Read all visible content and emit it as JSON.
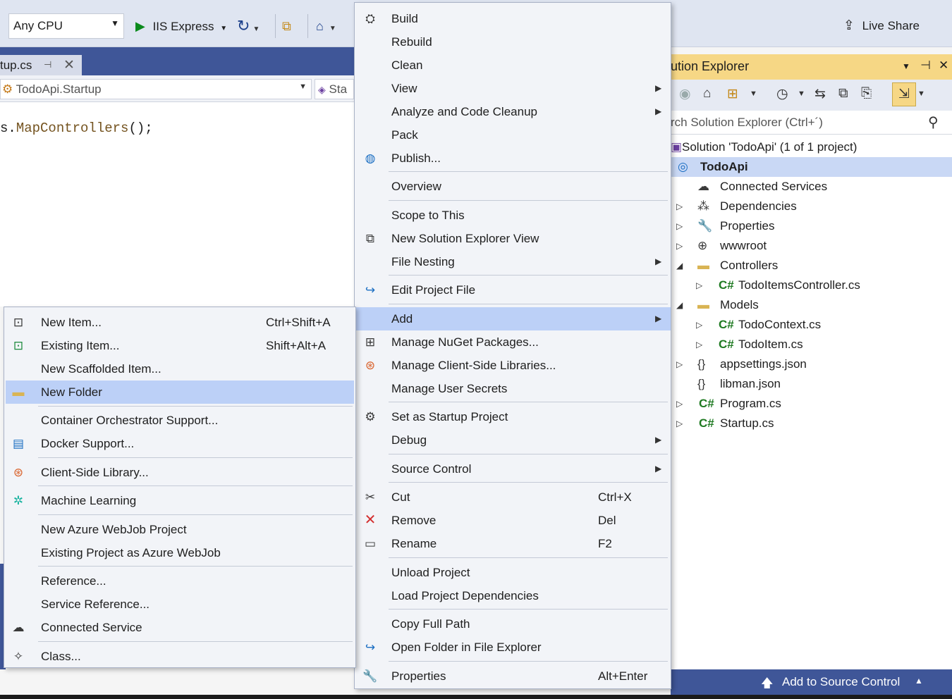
{
  "toolbar": {
    "platform": "Any CPU",
    "run_target": "IIS Express",
    "live_share": "Live Share"
  },
  "editor": {
    "tab_label": "tup.cs",
    "nav_left": "TodoApi.Startup",
    "nav_right": "Sta",
    "code_prefix": "s.",
    "code_method": "MapControllers",
    "code_suffix": "();"
  },
  "context_menu": {
    "items": [
      {
        "label": "Build",
        "icon": "build-icon"
      },
      {
        "label": "Rebuild"
      },
      {
        "label": "Clean"
      },
      {
        "label": "View",
        "submenu": true
      },
      {
        "label": "Analyze and Code Cleanup",
        "submenu": true
      },
      {
        "label": "Pack"
      },
      {
        "label": "Publish...",
        "icon": "globe-icon"
      },
      {
        "label": "Overview"
      },
      {
        "label": "Scope to This"
      },
      {
        "label": "New Solution Explorer View",
        "icon": "new-view-icon"
      },
      {
        "label": "File Nesting",
        "submenu": true
      },
      {
        "label": "Edit Project File",
        "icon": "edit-arrow-icon"
      },
      {
        "label": "Add",
        "submenu": true,
        "highlighted": true
      },
      {
        "label": "Manage NuGet Packages...",
        "icon": "nuget-icon"
      },
      {
        "label": "Manage Client-Side Libraries...",
        "icon": "client-lib-icon"
      },
      {
        "label": "Manage User Secrets"
      },
      {
        "label": "Set as Startup Project",
        "icon": "gear-icon"
      },
      {
        "label": "Debug",
        "submenu": true
      },
      {
        "label": "Source Control",
        "submenu": true
      },
      {
        "label": "Cut",
        "shortcut": "Ctrl+X",
        "icon": "scissors-icon"
      },
      {
        "label": "Remove",
        "shortcut": "Del",
        "icon": "remove-icon"
      },
      {
        "label": "Rename",
        "shortcut": "F2",
        "icon": "rename-icon"
      },
      {
        "label": "Unload Project"
      },
      {
        "label": "Load Project Dependencies"
      },
      {
        "label": "Copy Full Path"
      },
      {
        "label": "Open Folder in File Explorer",
        "icon": "open-folder-arrow-icon"
      },
      {
        "label": "Properties",
        "shortcut": "Alt+Enter",
        "icon": "wrench-icon"
      }
    ]
  },
  "add_submenu": {
    "items": [
      {
        "label": "New Item...",
        "shortcut": "Ctrl+Shift+A",
        "icon": "new-item-icon"
      },
      {
        "label": "Existing Item...",
        "shortcut": "Shift+Alt+A",
        "icon": "existing-item-icon"
      },
      {
        "label": "New Scaffolded Item..."
      },
      {
        "label": "New Folder",
        "highlighted": true,
        "icon": "new-folder-icon"
      },
      {
        "label": "Container Orchestrator Support..."
      },
      {
        "label": "Docker Support...",
        "icon": "docker-icon"
      },
      {
        "label": "Client-Side Library...",
        "icon": "client-lib-icon"
      },
      {
        "label": "Machine Learning",
        "icon": "ml-icon"
      },
      {
        "label": "New Azure WebJob Project"
      },
      {
        "label": "Existing Project as Azure WebJob"
      },
      {
        "label": "Reference..."
      },
      {
        "label": "Service Reference..."
      },
      {
        "label": "Connected Service",
        "icon": "connected-service-icon"
      },
      {
        "label": "Class...",
        "icon": "class-icon"
      }
    ]
  },
  "solution_explorer": {
    "title": "ution Explorer",
    "search_placeholder": "rch Solution Explorer (Ctrl+´)",
    "tree": [
      {
        "label": "Solution 'TodoApi' (1 of 1 project)",
        "icon": "solution-icon"
      },
      {
        "label": "TodoApi",
        "icon": "web-project-icon",
        "selected": true
      },
      {
        "label": "Connected Services",
        "icon": "connected-services-icon"
      },
      {
        "label": "Dependencies",
        "icon": "dependencies-icon"
      },
      {
        "label": "Properties",
        "icon": "wrench-icon"
      },
      {
        "label": "wwwroot",
        "icon": "globe-icon"
      },
      {
        "label": "Controllers",
        "icon": "folder-icon"
      },
      {
        "label": "TodoItemsController.cs",
        "icon": "csharp-icon"
      },
      {
        "label": "Models",
        "icon": "folder-icon"
      },
      {
        "label": "TodoContext.cs",
        "icon": "csharp-icon"
      },
      {
        "label": "TodoItem.cs",
        "icon": "csharp-icon"
      },
      {
        "label": "appsettings.json",
        "icon": "json-icon"
      },
      {
        "label": "libman.json",
        "icon": "json-icon"
      },
      {
        "label": "Program.cs",
        "icon": "csharp-icon"
      },
      {
        "label": "Startup.cs",
        "icon": "csharp-icon"
      }
    ]
  },
  "statusbar": {
    "source_control": "Add to Source Control"
  },
  "colors": {
    "accent": "#3f5698",
    "highlight": "#bcd0f7",
    "se_title": "#f6d785"
  }
}
